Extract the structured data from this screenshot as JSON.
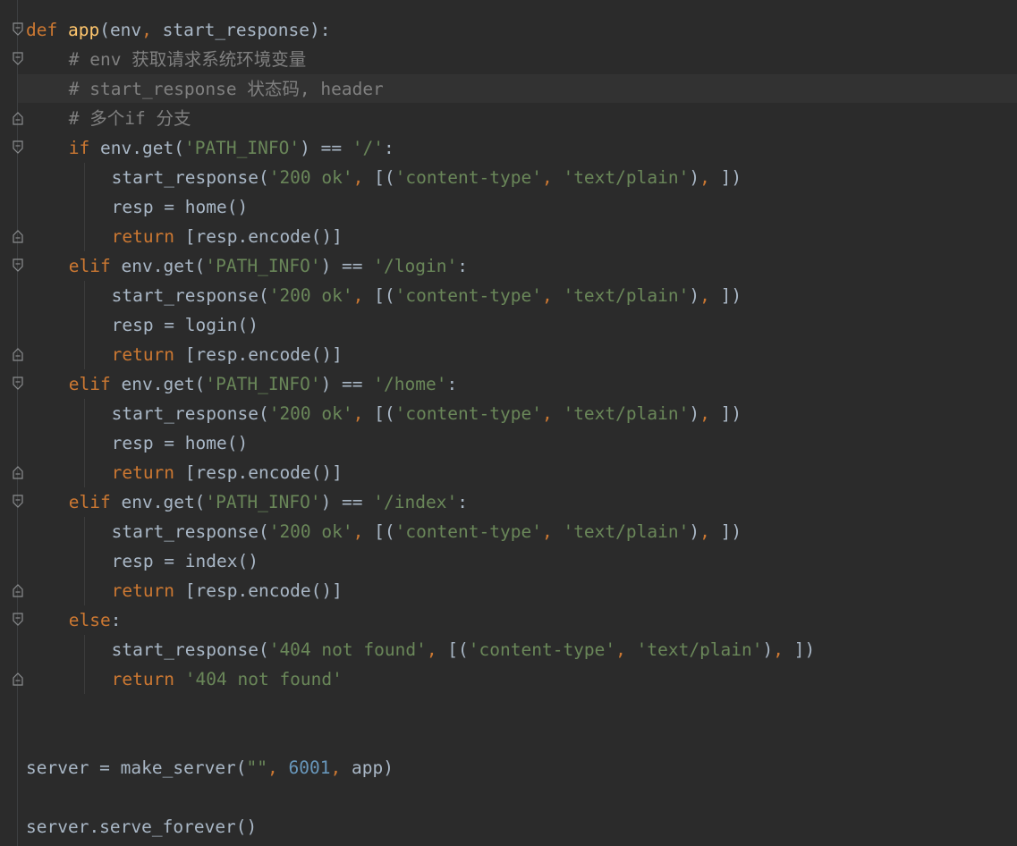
{
  "editor": {
    "colors": {
      "background": "#2b2b2b",
      "caret_row": "#323232",
      "keyword": "#cc7832",
      "function": "#ffc66d",
      "string": "#6a8759",
      "number": "#6897bb",
      "comment": "#808080",
      "identifier": "#a9b7c6"
    },
    "lines": [
      {
        "indent": 0,
        "tokens": [
          [
            "kw",
            "def "
          ],
          [
            "fn",
            "app"
          ],
          [
            "id",
            "(env"
          ],
          [
            "kw",
            ", "
          ],
          [
            "id",
            "start_response):"
          ]
        ]
      },
      {
        "indent": 1,
        "tokens": [
          [
            "cm",
            "# env 获取请求系统环境变量"
          ]
        ]
      },
      {
        "indent": 1,
        "tokens": [
          [
            "cm",
            "# start_response 状态码, header"
          ]
        ]
      },
      {
        "indent": 1,
        "tokens": [
          [
            "cm",
            "# 多个if 分支"
          ]
        ]
      },
      {
        "indent": 1,
        "tokens": [
          [
            "kw",
            "if "
          ],
          [
            "id",
            "env.get("
          ],
          [
            "str",
            "'PATH_INFO'"
          ],
          [
            "id",
            ") == "
          ],
          [
            "str",
            "'/'"
          ],
          [
            "id",
            ":"
          ]
        ]
      },
      {
        "indent": 2,
        "tokens": [
          [
            "id",
            "start_response("
          ],
          [
            "str",
            "'200 ok'"
          ],
          [
            "kw",
            ", "
          ],
          [
            "id",
            "[("
          ],
          [
            "str",
            "'content-type'"
          ],
          [
            "kw",
            ", "
          ],
          [
            "str",
            "'text/plain'"
          ],
          [
            "id",
            ")"
          ],
          [
            "kw",
            ", "
          ],
          [
            "id",
            "])"
          ]
        ]
      },
      {
        "indent": 2,
        "tokens": [
          [
            "id",
            "resp = home()"
          ]
        ]
      },
      {
        "indent": 2,
        "tokens": [
          [
            "kw",
            "return "
          ],
          [
            "id",
            "[resp.encode()]"
          ]
        ]
      },
      {
        "indent": 1,
        "tokens": [
          [
            "kw",
            "elif "
          ],
          [
            "id",
            "env.get("
          ],
          [
            "str",
            "'PATH_INFO'"
          ],
          [
            "id",
            ") == "
          ],
          [
            "str",
            "'/login'"
          ],
          [
            "id",
            ":"
          ]
        ]
      },
      {
        "indent": 2,
        "tokens": [
          [
            "id",
            "start_response("
          ],
          [
            "str",
            "'200 ok'"
          ],
          [
            "kw",
            ", "
          ],
          [
            "id",
            "[("
          ],
          [
            "str",
            "'content-type'"
          ],
          [
            "kw",
            ", "
          ],
          [
            "str",
            "'text/plain'"
          ],
          [
            "id",
            ")"
          ],
          [
            "kw",
            ", "
          ],
          [
            "id",
            "])"
          ]
        ]
      },
      {
        "indent": 2,
        "tokens": [
          [
            "id",
            "resp = login()"
          ]
        ]
      },
      {
        "indent": 2,
        "tokens": [
          [
            "kw",
            "return "
          ],
          [
            "id",
            "[resp.encode()]"
          ]
        ]
      },
      {
        "indent": 1,
        "tokens": [
          [
            "kw",
            "elif "
          ],
          [
            "id",
            "env.get("
          ],
          [
            "str",
            "'PATH_INFO'"
          ],
          [
            "id",
            ") == "
          ],
          [
            "str",
            "'/home'"
          ],
          [
            "id",
            ":"
          ]
        ]
      },
      {
        "indent": 2,
        "tokens": [
          [
            "id",
            "start_response("
          ],
          [
            "str",
            "'200 ok'"
          ],
          [
            "kw",
            ", "
          ],
          [
            "id",
            "[("
          ],
          [
            "str",
            "'content-type'"
          ],
          [
            "kw",
            ", "
          ],
          [
            "str",
            "'text/plain'"
          ],
          [
            "id",
            ")"
          ],
          [
            "kw",
            ", "
          ],
          [
            "id",
            "])"
          ]
        ]
      },
      {
        "indent": 2,
        "tokens": [
          [
            "id",
            "resp = home()"
          ]
        ]
      },
      {
        "indent": 2,
        "tokens": [
          [
            "kw",
            "return "
          ],
          [
            "id",
            "[resp.encode()]"
          ]
        ]
      },
      {
        "indent": 1,
        "tokens": [
          [
            "kw",
            "elif "
          ],
          [
            "id",
            "env.get("
          ],
          [
            "str",
            "'PATH_INFO'"
          ],
          [
            "id",
            ") == "
          ],
          [
            "str",
            "'/index'"
          ],
          [
            "id",
            ":"
          ]
        ]
      },
      {
        "indent": 2,
        "tokens": [
          [
            "id",
            "start_response("
          ],
          [
            "str",
            "'200 ok'"
          ],
          [
            "kw",
            ", "
          ],
          [
            "id",
            "[("
          ],
          [
            "str",
            "'content-type'"
          ],
          [
            "kw",
            ", "
          ],
          [
            "str",
            "'text/plain'"
          ],
          [
            "id",
            ")"
          ],
          [
            "kw",
            ", "
          ],
          [
            "id",
            "])"
          ]
        ]
      },
      {
        "indent": 2,
        "tokens": [
          [
            "id",
            "resp = index()"
          ]
        ]
      },
      {
        "indent": 2,
        "tokens": [
          [
            "kw",
            "return "
          ],
          [
            "id",
            "[resp.encode()]"
          ]
        ]
      },
      {
        "indent": 1,
        "tokens": [
          [
            "kw",
            "else"
          ],
          [
            "id",
            ":"
          ]
        ]
      },
      {
        "indent": 2,
        "tokens": [
          [
            "id",
            "start_response("
          ],
          [
            "str",
            "'404 not found'"
          ],
          [
            "kw",
            ", "
          ],
          [
            "id",
            "[("
          ],
          [
            "str",
            "'content-type'"
          ],
          [
            "kw",
            ", "
          ],
          [
            "str",
            "'text/plain'"
          ],
          [
            "id",
            ")"
          ],
          [
            "kw",
            ", "
          ],
          [
            "id",
            "])"
          ]
        ]
      },
      {
        "indent": 2,
        "tokens": [
          [
            "kw",
            "return "
          ],
          [
            "str",
            "'404 not found'"
          ]
        ]
      },
      {
        "indent": 0,
        "tokens": []
      },
      {
        "indent": 0,
        "tokens": []
      },
      {
        "indent": 0,
        "tokens": [
          [
            "id",
            "server = make_server("
          ],
          [
            "str",
            "\"\""
          ],
          [
            "kw",
            ", "
          ],
          [
            "num",
            "6001"
          ],
          [
            "kw",
            ", "
          ],
          [
            "id",
            "app)"
          ]
        ]
      },
      {
        "indent": 0,
        "tokens": []
      },
      {
        "indent": 0,
        "tokens": [
          [
            "id",
            "server.serve_forever()"
          ]
        ]
      }
    ],
    "fold_markers": [
      {
        "line": 0,
        "icon": "fold-open-icon"
      },
      {
        "line": 1,
        "icon": "fold-open-icon"
      },
      {
        "line": 3,
        "icon": "fold-close-icon"
      },
      {
        "line": 4,
        "icon": "fold-open-icon"
      },
      {
        "line": 7,
        "icon": "fold-close-icon"
      },
      {
        "line": 8,
        "icon": "fold-open-icon"
      },
      {
        "line": 11,
        "icon": "fold-close-icon"
      },
      {
        "line": 12,
        "icon": "fold-open-icon"
      },
      {
        "line": 15,
        "icon": "fold-close-icon"
      },
      {
        "line": 16,
        "icon": "fold-open-icon"
      },
      {
        "line": 19,
        "icon": "fold-close-icon"
      },
      {
        "line": 20,
        "icon": "fold-open-icon"
      },
      {
        "line": 22,
        "icon": "fold-close-icon"
      }
    ],
    "indent_guides": [
      {
        "from_line": 5,
        "to_line": 7
      },
      {
        "from_line": 9,
        "to_line": 11
      },
      {
        "from_line": 13,
        "to_line": 15
      },
      {
        "from_line": 17,
        "to_line": 19
      },
      {
        "from_line": 21,
        "to_line": 22
      }
    ]
  }
}
